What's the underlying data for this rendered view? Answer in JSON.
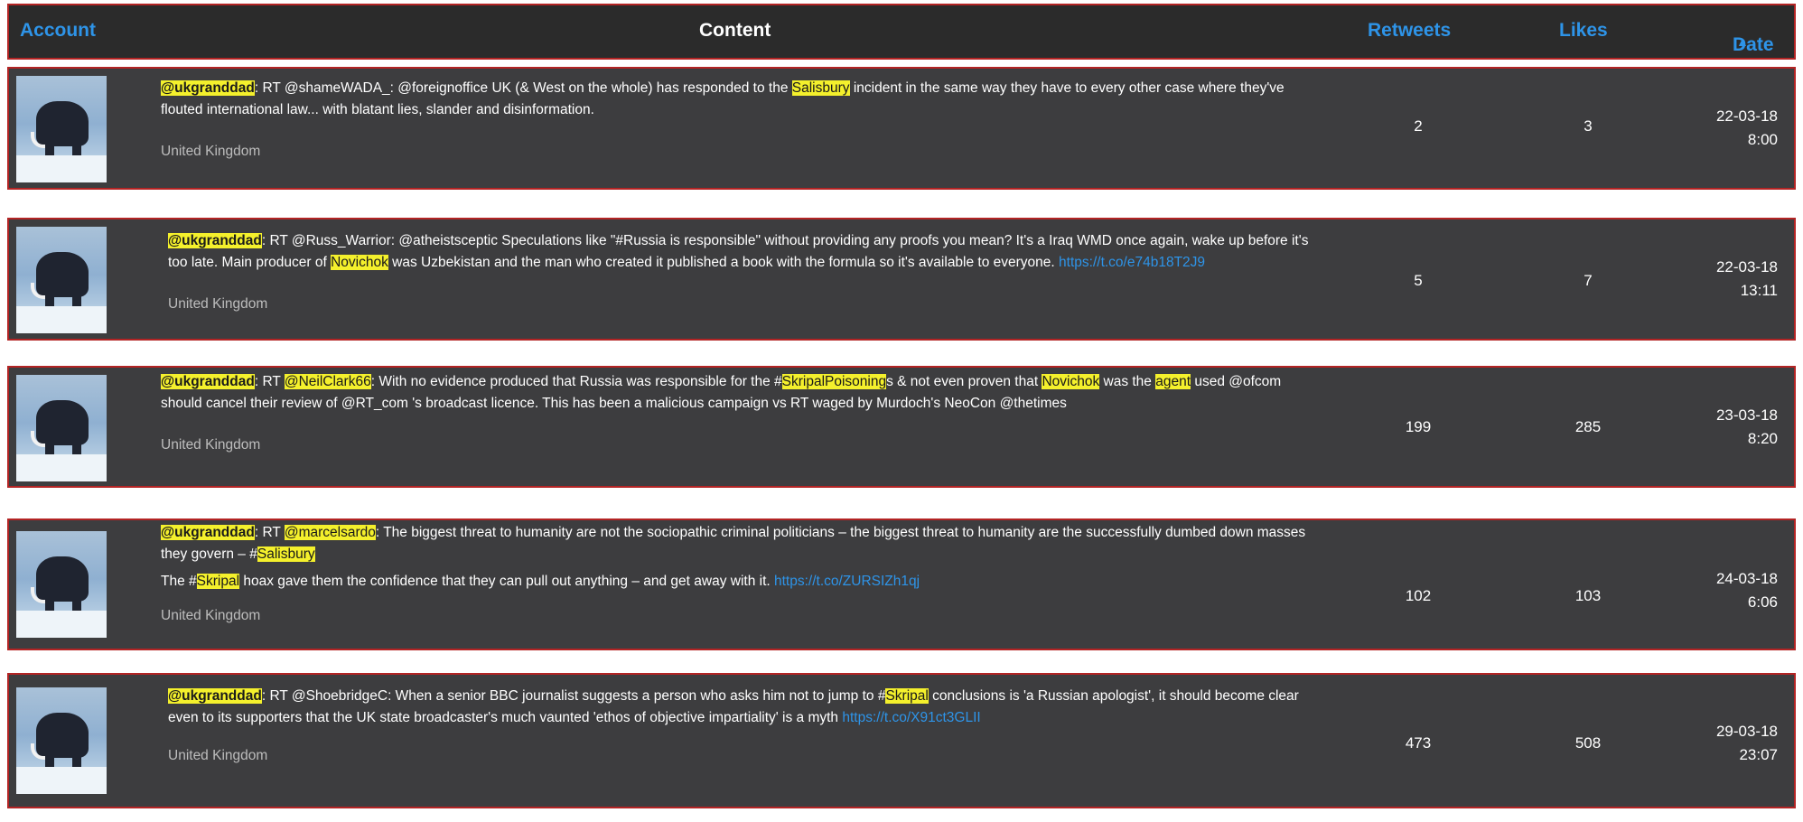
{
  "header": {
    "account": "Account",
    "content": "Content",
    "retweets": "Retweets",
    "likes": "Likes",
    "date": "Date",
    "sort_icon": "▲"
  },
  "rows": [
    {
      "user": "@ukgranddad",
      "location": "United Kingdom",
      "retweets": "2",
      "likes": "3",
      "date": "22-03-18",
      "time": "8:00"
    },
    {
      "user": "@ukgranddad",
      "location": "United Kingdom",
      "retweets": "5",
      "likes": "7",
      "date": "22-03-18",
      "time": "13:11"
    },
    {
      "user": "@ukgranddad",
      "location": "United Kingdom",
      "retweets": "199",
      "likes": "285",
      "date": "23-03-18",
      "time": "8:20"
    },
    {
      "user": "@ukgranddad",
      "location": "United Kingdom",
      "retweets": "102",
      "likes": "103",
      "date": "24-03-18",
      "time": "6:06"
    },
    {
      "user": "@ukgranddad",
      "location": "United Kingdom",
      "retweets": "473",
      "likes": "508",
      "date": "29-03-18",
      "time": "23:07"
    }
  ],
  "texts": {
    "r0_a": ": RT @shameWADA_: @foreignoffice UK (& West on the whole) has responded to the ",
    "r0_hl1": "Salisbury",
    "r0_b": " incident in the same way they have to every other case where they've flouted international law... with blatant lies, slander and disinformation.",
    "r1_a": ": RT @Russ_Warrior: @atheistsceptic Speculations like \"#Russia is responsible\" without providing any proofs you mean? It's a Iraq WMD once again, wake up before it's too late. Main producer of ",
    "r1_hl1": "Novichok",
    "r1_b": " was Uzbekistan and the man who created it published a book with the formula so it's available to everyone. ",
    "r1_link": "https://t.co/e74b18T2J9",
    "r2_a": ": RT ",
    "r2_hl1": "@NeilClark66",
    "r2_b": ": With no evidence produced that Russia was responsible for the #",
    "r2_hl2": "SkripalPoisoning",
    "r2_c": "s & not even proven that ",
    "r2_hl3": "Novichok",
    "r2_d": " was the ",
    "r2_hl4": "agent",
    "r2_e": " used @ofcom should cancel their review of @RT_com 's broadcast licence. This has been a malicious campaign vs RT waged by Murdoch's NeoCon @thetimes",
    "r3_a": ": RT ",
    "r3_hl1": "@marcelsardo",
    "r3_b": ": The biggest threat to humanity are not the sociopathic criminal politicians – the biggest threat to humanity are the successfully dumbed down masses they govern – #",
    "r3_hl2": "Salisbury",
    "r3_c": "The #",
    "r3_hl3": "Skripal",
    "r3_d": " hoax gave them the confidence that they can pull out anything – and get away with it. ",
    "r3_link": "https://t.co/ZURSIZh1qj",
    "r4_a": ": RT @ShoebridgeC: When a senior BBC journalist suggests a person who asks him not to jump to #",
    "r4_hl1": "Skripal",
    "r4_b": " conclusions is 'a Russian apologist', it should become clear even to its supporters that the UK state broadcaster's much vaunted 'ethos of objective impartiality' is a myth ",
    "r4_link": "https://t.co/X91ct3GLII"
  }
}
